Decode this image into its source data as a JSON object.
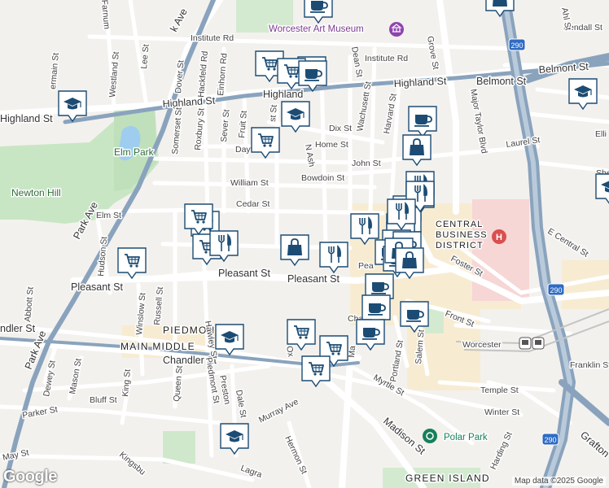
{
  "map": {
    "attribution": "Map data ©2025 Google",
    "logo": "Google",
    "highway_shields": [
      "290",
      "290",
      "290"
    ],
    "colors": {
      "marker": "#1c4c74",
      "park": "#c8e6c4",
      "highway": "#8aa3bd",
      "hospital": "#d94f4f"
    },
    "areas": {
      "central_business_district": [
        "CENTRAL",
        "BUSINESS",
        "DISTRICT"
      ],
      "piedmont": "PIEDMONT",
      "main_middle": "MAIN MIDDLE",
      "green_island": "GREEN ISLAND"
    },
    "places": {
      "art_museum": "Worcester Art Museum",
      "elm_park": "Elm Park",
      "newton_hill": "Newton Hill",
      "worcester_station": "Worcester",
      "polar_park": "Polar Park"
    },
    "streets": {
      "institute_rd_w": "Institute Rd",
      "institute_rd_e": "Institute Rd",
      "highland_st": "Highland St",
      "highland_st_2": "Highland St",
      "highland_st_3": "Highland",
      "belmont_st": "Belmont St",
      "dix_st": "Dix St",
      "home_st": "Home St",
      "john_st": "John St",
      "bowdoin_st": "Bowdoin St",
      "william_st": "William St",
      "cedar_st": "Cedar St",
      "elm_st": "Elm St",
      "pleasant_st": "Pleasant St",
      "pleasant_st_2": "Pleasant St",
      "pleasant_st_3": "Pleasant St",
      "chandler_st": "Chandler St",
      "chandler_st_w": "ndler St",
      "park_ave": "Park Ave",
      "park_ave_2": "Park Ave",
      "major_taylor": "Major Taylor Blvd",
      "foster_st": "Foster St",
      "e_central": "E Central St",
      "front_st": "Front St",
      "franklin_st": "Franklin St",
      "temple_st": "Temple St",
      "winter_st": "Winter St",
      "madison_st": "Madison St",
      "myrtle_st": "Myrtle St",
      "murray_ave": "Murray Ave",
      "hermon_st": "Hermon St",
      "parker_st": "Parker St",
      "bluff_st": "Bluff St",
      "may_st": "May St",
      "kendall_st": "Kendall St",
      "laurel_st": "Laurel St",
      "harvard_st": "Harvard St",
      "grove_st": "Grove St",
      "dean_st": "Dean St",
      "wachusett_st": "Wachusett St",
      "fruit_st": "Fruit St",
      "sever_st": "Sever St",
      "roxbury_st": "Roxbury St",
      "somerset_st": "Somerset St",
      "dover_st": "Dover St",
      "hackfeld_rd": "Hackfeld Rd",
      "einhorn_rd": "Einhorn Rd",
      "westland_st": "Westland St",
      "lee_st": "Lee St",
      "hudson_st": "Hudson St",
      "winslow_st": "Winslow St",
      "russell_st": "Russell St",
      "queen_st": "Queen St",
      "hawley_st": "Hawley St",
      "piedmont_st": "Piedmont St",
      "preston": "Preston",
      "dale_st": "Dale St",
      "abbott_st": "Abbott St",
      "dewey_st": "Dewey St",
      "mason_st": "Mason St",
      "king_st": "King St",
      "portland_st": "Portland St",
      "salem_st": "Salem St",
      "harding_st": "Harding St",
      "grafton": "Grafton",
      "shel": "She",
      "elli": "Elli",
      "ahl_st": "Ahl St",
      "park_st_ne": "k Ave",
      "farnum": "Farnum",
      "clayton": "Dayton",
      "dayton": "Dayton",
      "pearl": "Pea",
      "chatham": "Chatha",
      "laurel": "Laurel St",
      "mi": "Ma",
      "kingsbury": "Kingsbu",
      "lagrange": "Lagra",
      "bel": "Belmont St",
      "nash": "N Ash",
      "oxford": "Ox",
      "hi": "Hi",
      "ermain": "ermain St",
      "ist": "st St",
      "st": "St"
    },
    "markers": [
      {
        "type": "education",
        "icon": "school-icon"
      },
      {
        "type": "education",
        "icon": "school-icon"
      },
      {
        "type": "education",
        "icon": "school-icon"
      },
      {
        "type": "education",
        "icon": "school-icon"
      },
      {
        "type": "education",
        "icon": "school-icon"
      },
      {
        "type": "education",
        "icon": "school-icon"
      },
      {
        "type": "grocery",
        "icon": "shopping-cart-icon"
      },
      {
        "type": "grocery",
        "icon": "shopping-cart-icon"
      },
      {
        "type": "grocery",
        "icon": "shopping-cart-icon"
      },
      {
        "type": "grocery",
        "icon": "shopping-cart-icon"
      },
      {
        "type": "grocery",
        "icon": "shopping-cart-icon"
      },
      {
        "type": "grocery",
        "icon": "shopping-cart-icon"
      },
      {
        "type": "grocery",
        "icon": "shopping-cart-icon"
      },
      {
        "type": "grocery",
        "icon": "shopping-cart-icon"
      },
      {
        "type": "grocery",
        "icon": "shopping-cart-icon"
      },
      {
        "type": "grocery",
        "icon": "shopping-cart-icon"
      },
      {
        "type": "coffee",
        "icon": "coffee-cup-icon"
      },
      {
        "type": "coffee",
        "icon": "coffee-cup-icon"
      },
      {
        "type": "coffee",
        "icon": "coffee-cup-icon"
      },
      {
        "type": "coffee",
        "icon": "coffee-cup-icon"
      },
      {
        "type": "coffee",
        "icon": "coffee-cup-icon"
      },
      {
        "type": "coffee",
        "icon": "coffee-cup-icon"
      },
      {
        "type": "shopping",
        "icon": "shopping-bag-icon"
      },
      {
        "type": "shopping",
        "icon": "shopping-bag-icon"
      },
      {
        "type": "shopping",
        "icon": "shopping-bag-icon"
      },
      {
        "type": "restaurant",
        "icon": "fork-knife-icon"
      },
      {
        "type": "restaurant",
        "icon": "fork-knife-icon"
      },
      {
        "type": "restaurant",
        "icon": "fork-knife-icon"
      },
      {
        "type": "restaurant",
        "icon": "fork-knife-icon"
      },
      {
        "type": "restaurant",
        "icon": "fork-knife-icon"
      }
    ]
  }
}
